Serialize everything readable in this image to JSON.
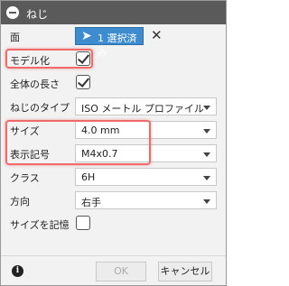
{
  "dialog": {
    "title": "ねじ"
  },
  "rows": {
    "face": {
      "label": "面",
      "button": "1 選択済み"
    },
    "modeled": {
      "label": "モデル化",
      "checked": true
    },
    "full_length": {
      "label": "全体の長さ",
      "checked": true
    },
    "thread_type": {
      "label": "ねじのタイプ",
      "value": "ISO メートル プロファイル"
    },
    "size": {
      "label": "サイズ",
      "value": "4.0 mm"
    },
    "designation": {
      "label": "表示記号",
      "value": "M4x0.7"
    },
    "class": {
      "label": "クラス",
      "value": "6H"
    },
    "direction": {
      "label": "方向",
      "value": "右手"
    },
    "remember_size": {
      "label": "サイズを記憶",
      "checked": false
    }
  },
  "footer": {
    "ok": "OK",
    "cancel": "キャンセル"
  },
  "colors": {
    "titlebar": "#5a5a5a",
    "select_button": "#3d8cd0",
    "highlight": "#f06a6a"
  }
}
